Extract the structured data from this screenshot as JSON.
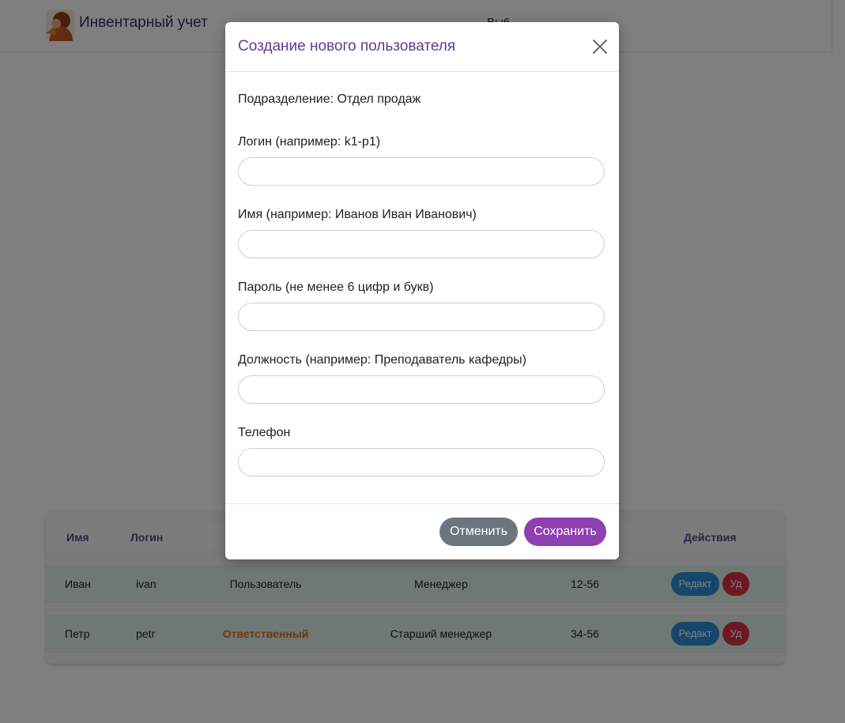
{
  "app": {
    "brand": "Инвентарный учет",
    "nav_fragment": "Вы6"
  },
  "table": {
    "headers": {
      "name": "Имя",
      "login": "Логин",
      "actions": "Действия"
    },
    "rows": [
      {
        "name": "Иван",
        "login": "ivan",
        "role": "Пользователь",
        "position": "Менеджер",
        "phone": "12-56",
        "edit": "Редакт",
        "delete": "Уд"
      },
      {
        "name": "Петр",
        "login": "petr",
        "role": "Ответственный",
        "position": "Старший менеджер",
        "phone": "34-56",
        "edit": "Редакт",
        "delete": "Уд"
      }
    ]
  },
  "modal": {
    "title": "Создание нового пользователя",
    "department": "Подразделение: Отдел продаж",
    "fields": {
      "login": {
        "label": "Логин (например: k1-p1)",
        "value": ""
      },
      "name": {
        "label": "Имя (например: Иванов Иван Иванович)",
        "value": ""
      },
      "password": {
        "label": "Пароль (не менее 6 цифр и букв)",
        "value": ""
      },
      "position": {
        "label": "Должность (например: Преподаватель кафедры)",
        "value": ""
      },
      "phone": {
        "label": "Телефон",
        "value": ""
      }
    },
    "cancel_label": "Отменить",
    "save_label": "Сохранить"
  },
  "colors": {
    "accent": "#8e3fb1",
    "cancel": "#6c757d",
    "edit": "#2d8fd6",
    "delete": "#dc2f45",
    "row_bg": "#dff1e9",
    "responsible": "#e0701a"
  }
}
